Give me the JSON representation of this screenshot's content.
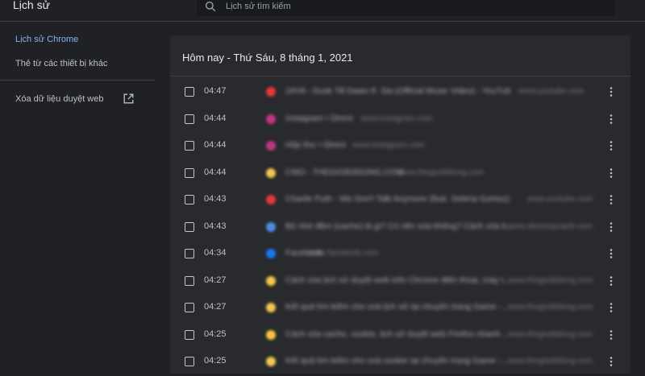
{
  "app": {
    "title": "Lịch sử"
  },
  "search": {
    "placeholder": "Lịch sử tìm kiếm"
  },
  "sidebar": {
    "items": [
      {
        "label": "Lịch sử Chrome"
      },
      {
        "label": "Thẻ từ các thiết bị khác"
      },
      {
        "label": "Xóa dữ liệu duyệt web"
      }
    ]
  },
  "main": {
    "date_header": "Hôm nay - Thứ Sáu, 8 tháng 1, 2021",
    "rows": [
      {
        "time": "04:47",
        "favicon_color": "#e53935",
        "title": "2AYA - Dusk Till Dawn ft. Sia (Official Music Video) - YouTube",
        "domain": "www.youtube.com"
      },
      {
        "time": "04:44",
        "favicon_color": "#c13584",
        "title": "Instagram • Direct",
        "domain": "www.instagram.com"
      },
      {
        "time": "04:44",
        "favicon_color": "#c13584",
        "title": "Hộp thư • Direct",
        "domain": "www.instagram.com"
      },
      {
        "time": "04:44",
        "favicon_color": "#f2c94c",
        "title": "CMO - THEGIOIDIDONG.COM",
        "domain": "www.thegioididong.com"
      },
      {
        "time": "04:43",
        "favicon_color": "#e53935",
        "title": "Charlie Puth - We Don't Talk Anymore (feat. Selena Gomez) [Off...",
        "domain": "www.youtube.com"
      },
      {
        "time": "04:43",
        "favicon_color": "#4a90e2",
        "title": "Bộ nhớ đệm (cache) là gì? Có nên xóa không? Cách xóa b...",
        "domain": "www.dienmayxanh.com"
      },
      {
        "time": "04:34",
        "favicon_color": "#1877f2",
        "title": "Facebook",
        "domain": "www.facebook.com"
      },
      {
        "time": "04:27",
        "favicon_color": "#f2c94c",
        "title": "Cách xóa lịch sử duyệt web trên Chrome điện thoại, máy t...",
        "domain": "www.thegioididong.com"
      },
      {
        "time": "04:27",
        "favicon_color": "#f2c94c",
        "title": "Kết quả tìm kiếm cho xoá lịch sử tại chuyên trang Game -...",
        "domain": "www.thegioididong.com"
      },
      {
        "time": "04:25",
        "favicon_color": "#f2c94c",
        "title": "Cách xóa cache, cookie, lịch sử duyệt web Firefox nhanh...",
        "domain": "www.thegioididong.com"
      },
      {
        "time": "04:25",
        "favicon_color": "#f2c94c",
        "title": "Kết quả tìm kiếm cho xoá cookie tại chuyên trang Game -...",
        "domain": "www.thegioididong.com"
      }
    ]
  },
  "colors": {
    "accent": "#8ab4f8",
    "background": "#202124",
    "card": "#292a2d"
  },
  "icons": {
    "search": "search-icon",
    "external": "open-in-new-icon",
    "more": "more-vert-icon"
  }
}
